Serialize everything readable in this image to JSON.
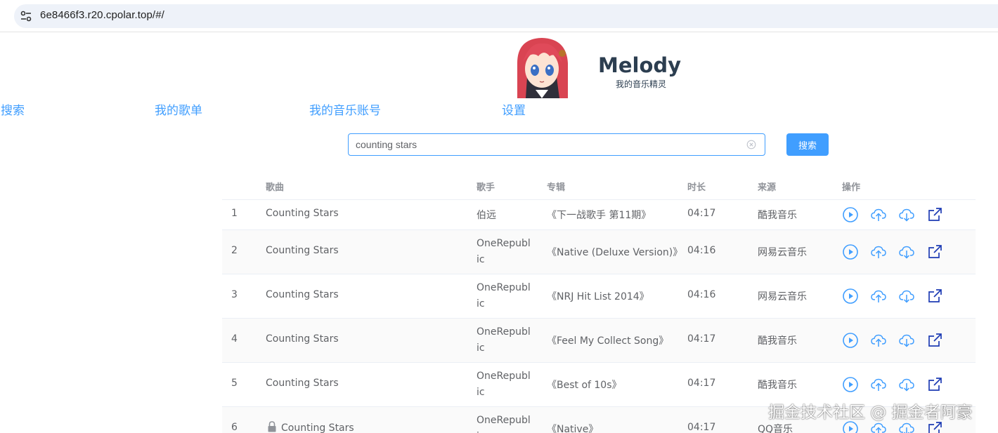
{
  "browser": {
    "url": "6e8466f3.r20.cpolar.top/#/"
  },
  "header": {
    "title": "Melody",
    "subtitle": "我的音乐精灵"
  },
  "nav": {
    "items": [
      {
        "label": "搜索"
      },
      {
        "label": "我的歌单"
      },
      {
        "label": "我的音乐账号"
      },
      {
        "label": "设置"
      }
    ]
  },
  "search": {
    "value": "counting stars",
    "button_label": "搜索"
  },
  "table": {
    "columns": [
      "歌曲",
      "歌手",
      "专辑",
      "时长",
      "来源",
      "操作"
    ],
    "rows": [
      {
        "index": "1",
        "song": "Counting Stars",
        "singer": "伯远",
        "album": "《下一战歌手 第11期》",
        "duration": "04:17",
        "source": "酷我音乐"
      },
      {
        "index": "2",
        "song": "Counting Stars",
        "singer": "OneRepublic",
        "album": "《Native (Deluxe Version)》",
        "duration": "04:16",
        "source": "网易云音乐"
      },
      {
        "index": "3",
        "song": "Counting Stars",
        "singer": "OneRepublic",
        "album": "《NRJ Hit List 2014》",
        "duration": "04:16",
        "source": "网易云音乐"
      },
      {
        "index": "4",
        "song": "Counting Stars",
        "singer": "OneRepublic",
        "album": "《Feel My Collect Song》",
        "duration": "04:17",
        "source": "酷我音乐"
      },
      {
        "index": "5",
        "song": "Counting Stars",
        "singer": "OneRepublic",
        "album": "《Best of 10s》",
        "duration": "04:17",
        "source": "酷我音乐"
      },
      {
        "index": "6",
        "song": "Counting Stars",
        "singer": "OneRepublic",
        "album": "《Native》",
        "duration": "04:17",
        "source": "QQ音乐",
        "locked": true
      }
    ]
  },
  "watermark": "掘金技术社区 @ 掘金者阿豪",
  "colors": {
    "accent": "#409eff",
    "title": "#2c3e50",
    "text": "#606266",
    "header_text": "#909399",
    "stripe": "#fafafa",
    "link_icon": "#1e3cb4"
  },
  "icons": [
    "tune-icon",
    "clear-icon",
    "play-icon",
    "upload-cloud-icon",
    "download-cloud-icon",
    "external-link-icon",
    "lock-icon"
  ]
}
